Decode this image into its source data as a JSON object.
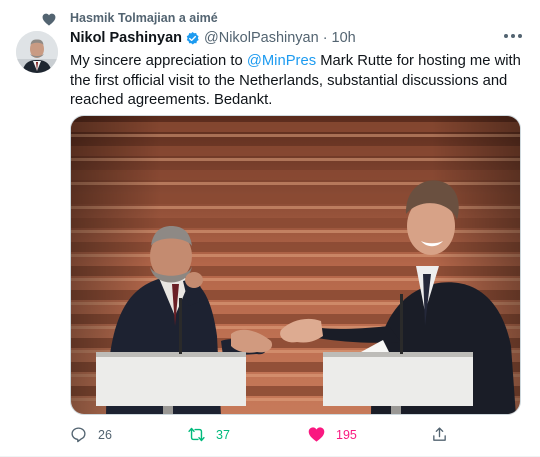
{
  "social_context": {
    "text": "Hasmik Tolmajian a aimé",
    "icon": "heart-icon"
  },
  "tweet": {
    "author_name": "Nikol Pashinyan",
    "verified": true,
    "handle": "@NikolPashinyan",
    "separator": "·",
    "time": "10h",
    "text_before_mention": "My sincere appreciation to ",
    "mention": "@MinPres",
    "text_after_mention": " Mark Rutte for hosting me with the first official visit to the Netherlands, substantial discussions and reached agreements. Bedankt."
  },
  "actions": {
    "reply": {
      "icon": "reply-icon",
      "count": "26"
    },
    "retweet": {
      "icon": "retweet-icon",
      "count": "37",
      "color": "#00ba7c"
    },
    "like": {
      "icon": "heart-filled-icon",
      "count": "195",
      "color": "#f91880",
      "liked": true
    },
    "share": {
      "icon": "share-icon"
    }
  },
  "colors": {
    "accent": "#1d9bf0",
    "secondary_text": "#536471",
    "retweet": "#00ba7c",
    "like": "#f91880"
  }
}
